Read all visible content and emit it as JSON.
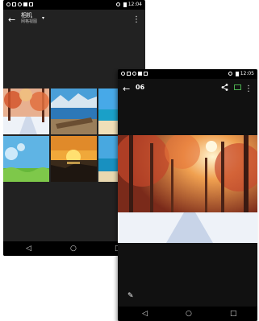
{
  "back_screen": {
    "status_time": "12:04",
    "album_title": "相机",
    "album_subtitle": "网格视图",
    "menu_glyph": "⋮",
    "back_glyph": "←",
    "nav": {
      "back": "◁",
      "home": "○",
      "recents": "□"
    }
  },
  "front_screen": {
    "status_time": "12:05",
    "photo_title": "06",
    "menu_glyph": "⋮",
    "back_glyph": "←",
    "icons": [
      "share-icon",
      "cast-icon",
      "edit-icon"
    ],
    "nav": {
      "back": "◁",
      "home": "○",
      "recents": "□"
    }
  },
  "colors": {
    "background": "#ffffff",
    "screen": "#1a1a1a",
    "statusbar": "#000000",
    "cast_accent": "#4caf50"
  }
}
